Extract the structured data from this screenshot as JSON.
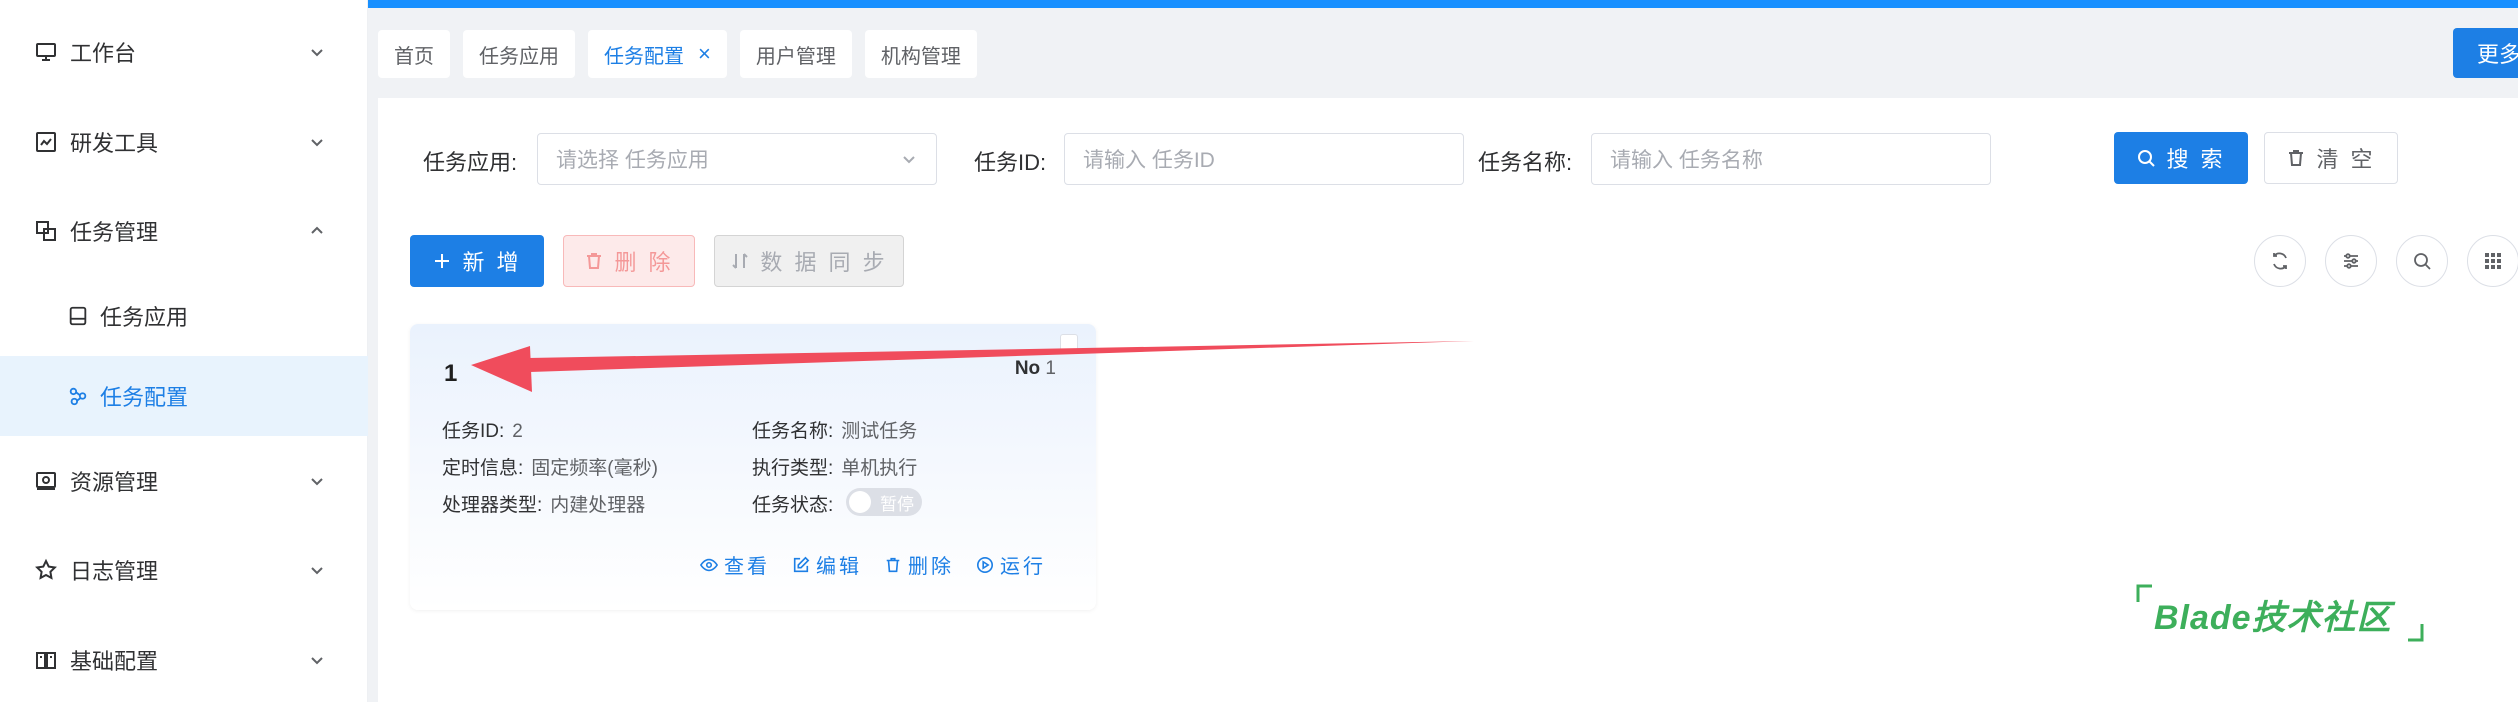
{
  "sidebar": {
    "items": [
      {
        "label": "工作台",
        "icon": "monitor-icon",
        "expanded": false
      },
      {
        "label": "研发工具",
        "icon": "code-tool-icon",
        "expanded": false
      },
      {
        "label": "任务管理",
        "icon": "task-icon",
        "expanded": true
      },
      {
        "label": "资源管理",
        "icon": "resource-icon",
        "expanded": false
      },
      {
        "label": "日志管理",
        "icon": "star-icon",
        "expanded": false
      },
      {
        "label": "基础配置",
        "icon": "book-icon",
        "expanded": false
      }
    ],
    "sub_items": [
      {
        "label": "任务应用",
        "icon": "app-icon",
        "active": false
      },
      {
        "label": "任务配置",
        "icon": "config-icon",
        "active": true
      }
    ]
  },
  "tabs": [
    {
      "label": "首页",
      "active": false
    },
    {
      "label": "任务应用",
      "active": false
    },
    {
      "label": "任务配置",
      "active": true,
      "closable": true
    },
    {
      "label": "用户管理",
      "active": false
    },
    {
      "label": "机构管理",
      "active": false
    }
  ],
  "more_label": "更多",
  "search": {
    "app_label": "任务应用:",
    "app_placeholder": "请选择 任务应用",
    "id_label": "任务ID:",
    "id_placeholder": "请输入 任务ID",
    "name_label": "任务名称:",
    "name_placeholder": "请输入 任务名称",
    "search_label": "搜 索",
    "clear_label": "清 空"
  },
  "toolbar": {
    "add_label": "新 增",
    "delete_label": "删 除",
    "sync_label": "数 据 同 步"
  },
  "card": {
    "title": "1",
    "no_label": "No",
    "no_value": "1",
    "task_id_label": "任务ID:",
    "task_id_value": "2",
    "task_name_label": "任务名称:",
    "task_name_value": "测试任务",
    "schedule_label": "定时信息:",
    "schedule_value": "固定频率(毫秒)",
    "exec_type_label": "执行类型:",
    "exec_type_value": "单机执行",
    "handler_label": "处理器类型:",
    "handler_value": "内建处理器",
    "status_label": "任务状态:",
    "status_value": "暂停",
    "actions": {
      "view": "查看",
      "edit": "编辑",
      "delete": "删除",
      "run": "运行"
    }
  },
  "watermark": "Blade技术社区",
  "colors": {
    "primary": "#1d7fe5",
    "danger": "#f49898",
    "annotation": "#f04c5c",
    "watermark": "#3daf5b"
  }
}
